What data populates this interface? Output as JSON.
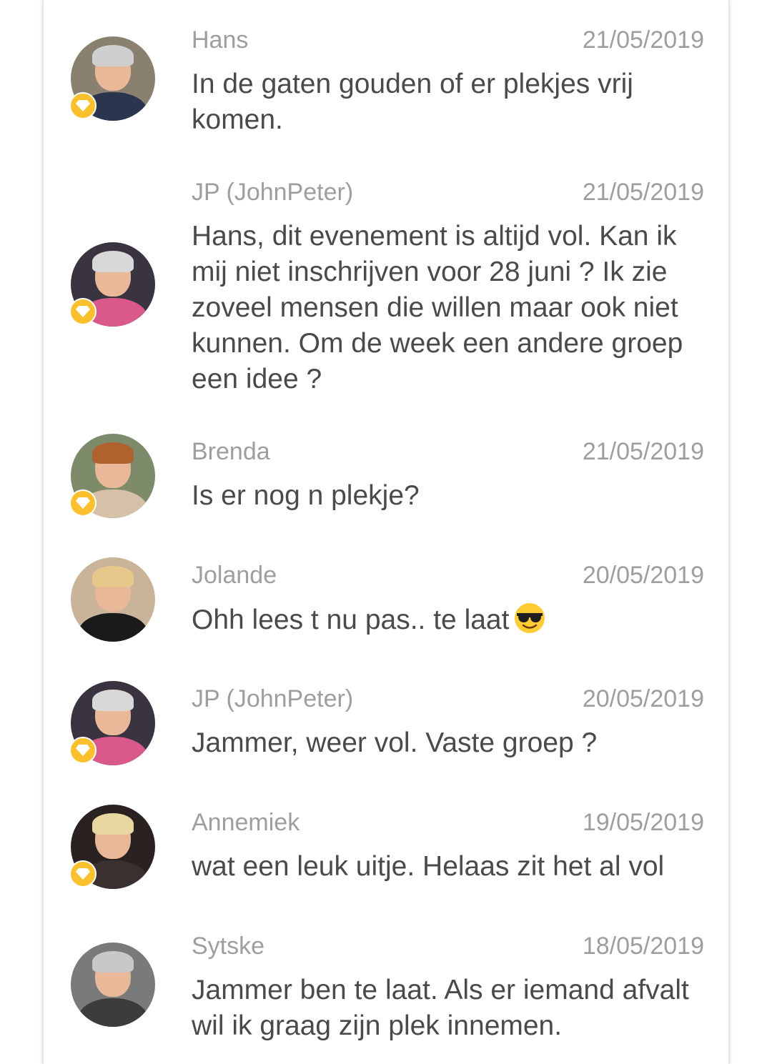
{
  "comments": [
    {
      "author": "Hans",
      "date": "21/05/2019",
      "text": "In de gaten gouden of er plekjes vrij komen.",
      "has_badge": true,
      "avatar": {
        "bg": "#8a8070",
        "hair": "#cfcfcf",
        "shirt": "#2b3550"
      }
    },
    {
      "author": "JP (JohnPeter)",
      "date": "21/05/2019",
      "text": "Hans, dit evenement is altijd vol. Kan ik mij niet inschrijven voor 28 juni ? Ik zie zoveel mensen die willen maar ook niet kunnen. Om de week een andere groep een idee ?",
      "has_badge": true,
      "avatar": {
        "bg": "#3a3440",
        "hair": "#d8d8d8",
        "shirt": "#d95a8a"
      }
    },
    {
      "author": "Brenda",
      "date": "21/05/2019",
      "text": "Is er nog n plekje?",
      "has_badge": true,
      "avatar": {
        "bg": "#7d8b6a",
        "hair": "#b0622e",
        "shirt": "#d7c0a8"
      }
    },
    {
      "author": "Jolande",
      "date": "20/05/2019",
      "text": "Ohh lees t nu pas.. te laat",
      "emoji": "smiling-face-with-sunglasses",
      "has_badge": false,
      "avatar": {
        "bg": "#c9b49a",
        "hair": "#e6c98a",
        "shirt": "#1a1a1a"
      }
    },
    {
      "author": "JP (JohnPeter)",
      "date": "20/05/2019",
      "text": "Jammer, weer vol. Vaste groep ?",
      "has_badge": true,
      "avatar": {
        "bg": "#3a3440",
        "hair": "#d8d8d8",
        "shirt": "#d95a8a"
      }
    },
    {
      "author": "Annemiek",
      "date": "19/05/2019",
      "text": "wat een leuk uitje. Helaas zit het al vol",
      "has_badge": true,
      "avatar": {
        "bg": "#2a2220",
        "hair": "#e8d6a0",
        "shirt": "#3a3030"
      }
    },
    {
      "author": "Sytske",
      "date": "18/05/2019",
      "text": "Jammer ben te laat. Als er iemand afvalt wil ik graag zijn plek innemen.",
      "has_badge": false,
      "avatar": {
        "bg": "#7a7a7a",
        "hair": "#c8c8c8",
        "shirt": "#3c3c3c"
      }
    }
  ],
  "badge_icon": "diamond-icon",
  "colors": {
    "badge": "#fbc02d",
    "name": "#9e9e9e",
    "text": "#4a4a4a"
  }
}
